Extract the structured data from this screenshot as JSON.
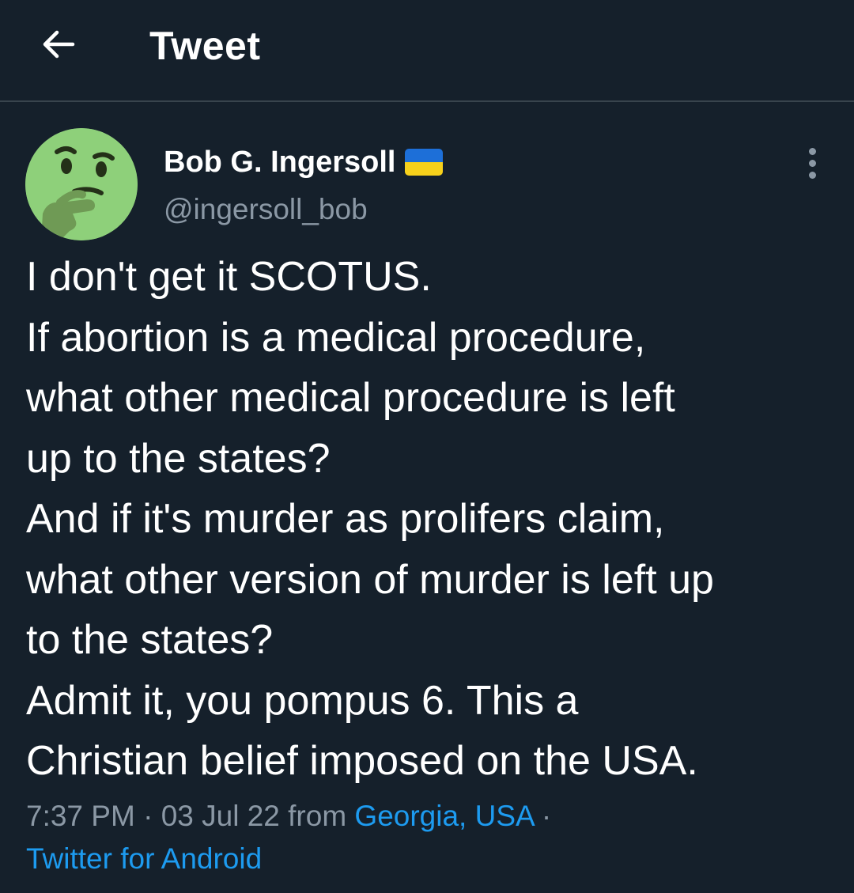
{
  "header": {
    "back_icon": "arrow-left-icon",
    "title": "Tweet"
  },
  "author": {
    "avatar_icon": "thinking-face-icon",
    "display_name": "Bob G. Ingersoll",
    "flag_icon": "ukraine-flag-icon",
    "handle": "@ingersoll_bob",
    "more_icon": "more-vertical-icon"
  },
  "tweet": {
    "lines": [
      "I don't get it SCOTUS.",
      "If abortion is a medical procedure,",
      "what other medical procedure is left",
      "up to the states?",
      "And if it's murder as prolifers claim,",
      "what other version of murder is left up",
      "to the states?",
      "Admit it, you pompus 6. This a",
      "Christian belief imposed on the USA."
    ]
  },
  "meta": {
    "time": "7:37 PM",
    "separator": " · ",
    "date": "03 Jul 22",
    "from_text": " from ",
    "location": "Georgia, USA",
    "trailing_separator": " ·",
    "client": "Twitter for Android"
  },
  "colors": {
    "background": "#15202b",
    "text": "#ffffff",
    "secondary_text": "#8b98a5",
    "link": "#1d9bf0",
    "divider": "#38444d",
    "flag_blue": "#1d6fd8",
    "flag_yellow": "#f7d11b",
    "avatar_bg": "#8ed07a"
  }
}
